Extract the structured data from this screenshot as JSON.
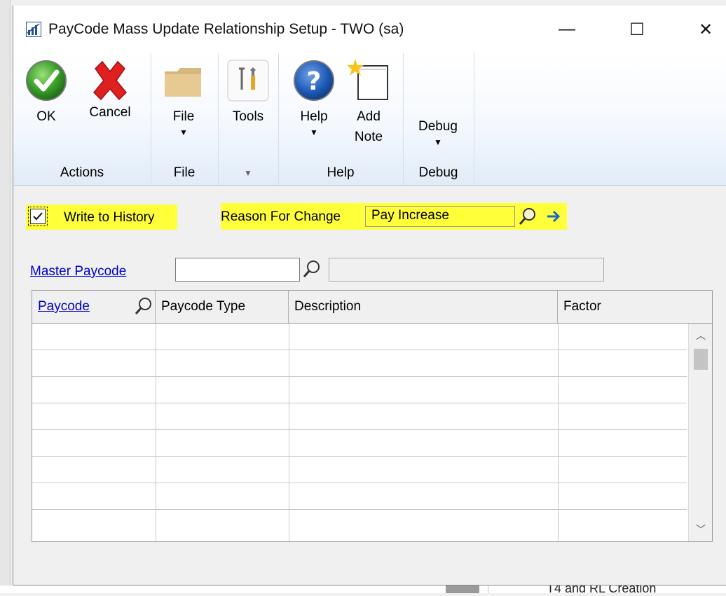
{
  "window": {
    "title": "PayCode Mass Update Relationship Setup  -  TWO (sa)",
    "controls": {
      "minimize": "—",
      "maximize": "☐",
      "close": "✕"
    }
  },
  "ribbon": {
    "ok_label": "OK",
    "cancel_label": "Cancel",
    "actions_group": "Actions",
    "file_label": "File",
    "file_group": "File",
    "tools_label": "Tools",
    "help_label": "Help",
    "add_note_line1": "Add",
    "add_note_line2": "Note",
    "help_group": "Help",
    "debug_label": "Debug",
    "debug_group": "Debug"
  },
  "form": {
    "write_to_history_label": "Write to History",
    "write_to_history_checked": true,
    "reason_label": "Reason For Change",
    "reason_value": "Pay Increase",
    "master_paycode_label": "Master Paycode",
    "master_paycode_value": "",
    "highlight_color": "#ffff3a"
  },
  "grid": {
    "columns": [
      "Paycode",
      "Paycode Type",
      "Description",
      "Factor"
    ],
    "rows": [
      [
        "",
        "",
        "",
        ""
      ],
      [
        "",
        "",
        "",
        ""
      ],
      [
        "",
        "",
        "",
        ""
      ],
      [
        "",
        "",
        "",
        ""
      ],
      [
        "",
        "",
        "",
        ""
      ],
      [
        "",
        "",
        "",
        ""
      ],
      [
        "",
        "",
        "",
        ""
      ],
      [
        "",
        "",
        "",
        ""
      ]
    ]
  },
  "background": {
    "bottom_text": "T4 and RL Creation"
  },
  "icons": [
    "app-icon",
    "ok-check-icon",
    "cancel-x-icon",
    "folder-icon",
    "tools-icon",
    "help-question-icon",
    "note-icon",
    "lookup-magnifier-icon",
    "arrow-right-icon"
  ]
}
